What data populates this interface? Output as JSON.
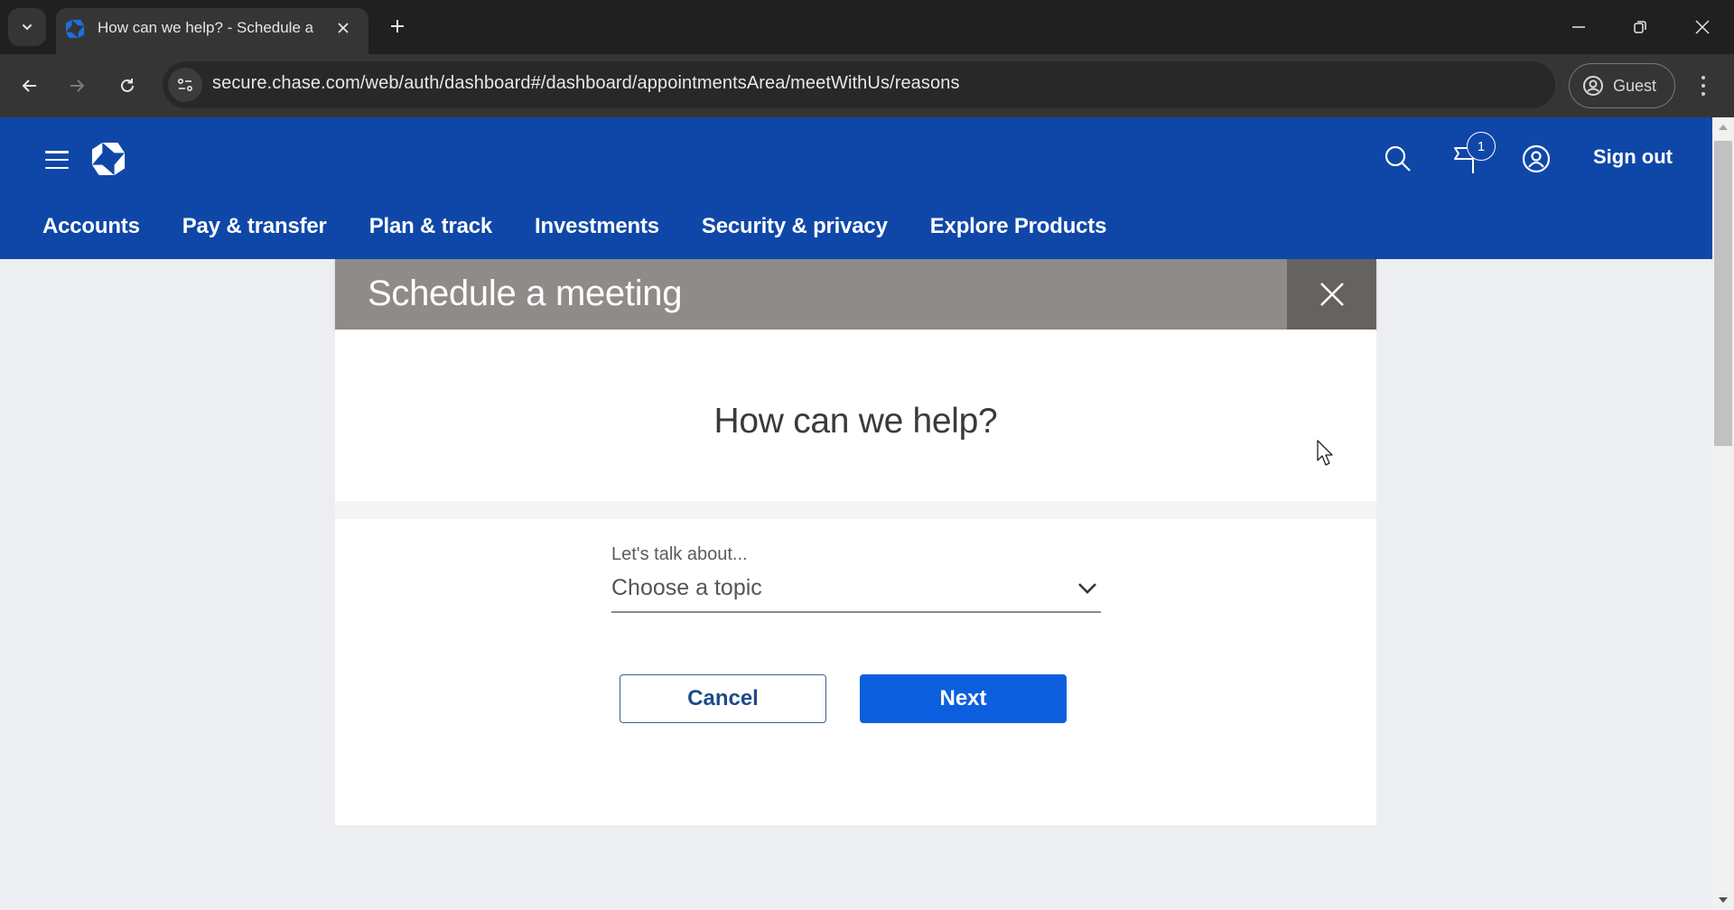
{
  "browser": {
    "tab": {
      "title": "How can we help? - Schedule a",
      "favicon": "chase-logo-icon",
      "close_icon": "close-icon"
    },
    "new_tab_icon": "plus-icon",
    "tab_search_icon": "chevron-down-icon",
    "window_controls": [
      "minimize-icon",
      "restore-icon",
      "close-icon"
    ],
    "nav": {
      "back": "arrow-left-icon",
      "forward": "arrow-right-icon",
      "reload": "reload-icon"
    },
    "url": "secure.chase.com/web/auth/dashboard#/dashboard/appointmentsArea/meetWithUs/reasons",
    "site_info_icon": "tune-icon",
    "profile_label": "Guest",
    "menu_icon": "kebab-icon"
  },
  "header": {
    "menu_icon": "hamburger-icon",
    "logo": "chase-logo-icon",
    "search_icon": "search-icon",
    "notifications": {
      "icon": "flag-icon",
      "count": "1"
    },
    "profile_icon": "user-circle-icon",
    "sign_out_label": "Sign out",
    "brand_color": "#0f47a8"
  },
  "main_nav": [
    {
      "label": "Accounts"
    },
    {
      "label": "Pay & transfer"
    },
    {
      "label": "Plan & track"
    },
    {
      "label": "Investments"
    },
    {
      "label": "Security & privacy"
    },
    {
      "label": "Explore Products"
    }
  ],
  "modal": {
    "title": "Schedule a meeting",
    "close_icon": "close-icon",
    "heading": "How can we help?",
    "topic": {
      "label": "Let's talk about...",
      "selected": "Choose a topic",
      "chevron_icon": "chevron-down-icon"
    },
    "buttons": {
      "cancel": "Cancel",
      "next": "Next"
    },
    "primary_color": "#0b5fdf"
  }
}
